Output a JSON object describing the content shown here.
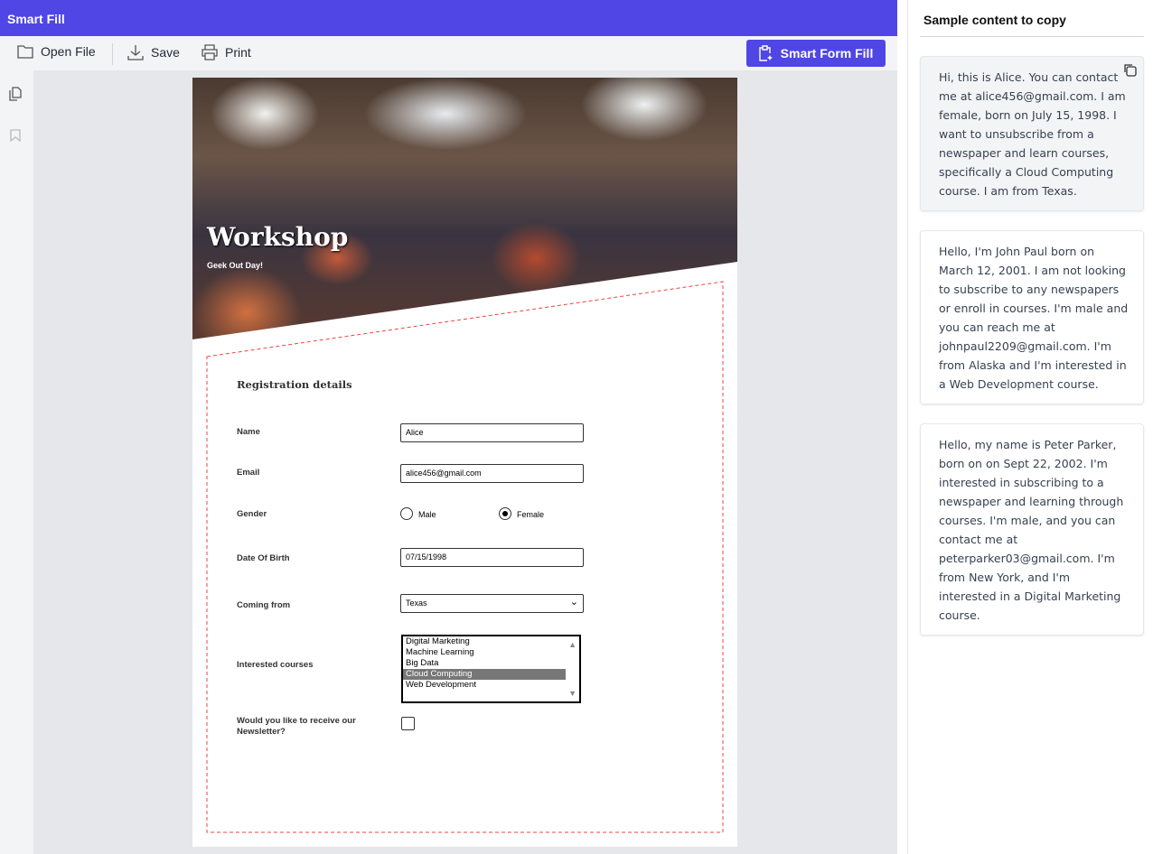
{
  "app": {
    "title": "Smart Fill"
  },
  "toolbar": {
    "open": "Open File",
    "save": "Save",
    "print": "Print",
    "smart": "Smart Form Fill"
  },
  "doc": {
    "title": "Workshop",
    "subtitle": "Geek Out Day!",
    "section": "Registration details",
    "fields": {
      "name_label": "Name",
      "name": "Alice",
      "email_label": "Email",
      "email": "alice456@gmail.com",
      "gender_label": "Gender",
      "male": "Male",
      "female": "Female",
      "gender_selected": "Female",
      "dob_label": "Date Of Birth",
      "dob": "07/15/1998",
      "from_label": "Coming from",
      "from": "Texas",
      "courses_label": "Interested courses",
      "courses": [
        "Digital Marketing",
        "Machine Learning",
        "Big Data",
        "Cloud Computing",
        "Web Development"
      ],
      "courses_selected": "Cloud Computing",
      "newsletter_label": "Would you like to receive our Newsletter?",
      "newsletter": false
    }
  },
  "panel": {
    "title": "Sample content to copy",
    "samples": [
      "Hi, this is Alice. You can contact me at alice456@gmail.com. I am female, born on July 15, 1998. I want to unsubscribe from a newspaper and learn courses, specifically a Cloud Computing course. I am from Texas.",
      "Hello, I'm John Paul born on March 12, 2001. I am not looking to subscribe to any newspapers or enroll in courses. I'm male and you can reach me at johnpaul2209@gmail.com. I'm from Alaska and I'm interested in a Web Development course.",
      "Hello, my name is Peter Parker, born on on Sept 22, 2002. I'm interested in subscribing to a newspaper and learning through courses. I'm male, and you can contact me at peterparker03@gmail.com. I'm from New York, and I'm interested in a Digital Marketing course."
    ]
  }
}
